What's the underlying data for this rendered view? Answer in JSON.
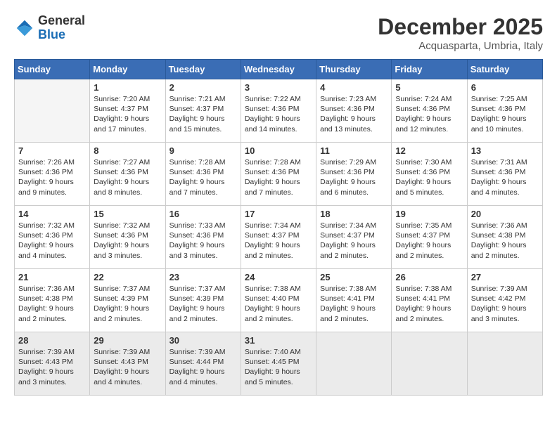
{
  "header": {
    "logo": {
      "general": "General",
      "blue": "Blue"
    },
    "title": "December 2025",
    "subtitle": "Acquasparta, Umbria, Italy"
  },
  "days_of_week": [
    "Sunday",
    "Monday",
    "Tuesday",
    "Wednesday",
    "Thursday",
    "Friday",
    "Saturday"
  ],
  "weeks": [
    [
      {
        "day": "",
        "info": ""
      },
      {
        "day": "1",
        "info": "Sunrise: 7:20 AM\nSunset: 4:37 PM\nDaylight: 9 hours\nand 17 minutes."
      },
      {
        "day": "2",
        "info": "Sunrise: 7:21 AM\nSunset: 4:37 PM\nDaylight: 9 hours\nand 15 minutes."
      },
      {
        "day": "3",
        "info": "Sunrise: 7:22 AM\nSunset: 4:36 PM\nDaylight: 9 hours\nand 14 minutes."
      },
      {
        "day": "4",
        "info": "Sunrise: 7:23 AM\nSunset: 4:36 PM\nDaylight: 9 hours\nand 13 minutes."
      },
      {
        "day": "5",
        "info": "Sunrise: 7:24 AM\nSunset: 4:36 PM\nDaylight: 9 hours\nand 12 minutes."
      },
      {
        "day": "6",
        "info": "Sunrise: 7:25 AM\nSunset: 4:36 PM\nDaylight: 9 hours\nand 10 minutes."
      }
    ],
    [
      {
        "day": "7",
        "info": "Sunrise: 7:26 AM\nSunset: 4:36 PM\nDaylight: 9 hours\nand 9 minutes."
      },
      {
        "day": "8",
        "info": "Sunrise: 7:27 AM\nSunset: 4:36 PM\nDaylight: 9 hours\nand 8 minutes."
      },
      {
        "day": "9",
        "info": "Sunrise: 7:28 AM\nSunset: 4:36 PM\nDaylight: 9 hours\nand 7 minutes."
      },
      {
        "day": "10",
        "info": "Sunrise: 7:28 AM\nSunset: 4:36 PM\nDaylight: 9 hours\nand 7 minutes."
      },
      {
        "day": "11",
        "info": "Sunrise: 7:29 AM\nSunset: 4:36 PM\nDaylight: 9 hours\nand 6 minutes."
      },
      {
        "day": "12",
        "info": "Sunrise: 7:30 AM\nSunset: 4:36 PM\nDaylight: 9 hours\nand 5 minutes."
      },
      {
        "day": "13",
        "info": "Sunrise: 7:31 AM\nSunset: 4:36 PM\nDaylight: 9 hours\nand 4 minutes."
      }
    ],
    [
      {
        "day": "14",
        "info": "Sunrise: 7:32 AM\nSunset: 4:36 PM\nDaylight: 9 hours\nand 4 minutes."
      },
      {
        "day": "15",
        "info": "Sunrise: 7:32 AM\nSunset: 4:36 PM\nDaylight: 9 hours\nand 3 minutes."
      },
      {
        "day": "16",
        "info": "Sunrise: 7:33 AM\nSunset: 4:36 PM\nDaylight: 9 hours\nand 3 minutes."
      },
      {
        "day": "17",
        "info": "Sunrise: 7:34 AM\nSunset: 4:37 PM\nDaylight: 9 hours\nand 2 minutes."
      },
      {
        "day": "18",
        "info": "Sunrise: 7:34 AM\nSunset: 4:37 PM\nDaylight: 9 hours\nand 2 minutes."
      },
      {
        "day": "19",
        "info": "Sunrise: 7:35 AM\nSunset: 4:37 PM\nDaylight: 9 hours\nand 2 minutes."
      },
      {
        "day": "20",
        "info": "Sunrise: 7:36 AM\nSunset: 4:38 PM\nDaylight: 9 hours\nand 2 minutes."
      }
    ],
    [
      {
        "day": "21",
        "info": "Sunrise: 7:36 AM\nSunset: 4:38 PM\nDaylight: 9 hours\nand 2 minutes."
      },
      {
        "day": "22",
        "info": "Sunrise: 7:37 AM\nSunset: 4:39 PM\nDaylight: 9 hours\nand 2 minutes."
      },
      {
        "day": "23",
        "info": "Sunrise: 7:37 AM\nSunset: 4:39 PM\nDaylight: 9 hours\nand 2 minutes."
      },
      {
        "day": "24",
        "info": "Sunrise: 7:38 AM\nSunset: 4:40 PM\nDaylight: 9 hours\nand 2 minutes."
      },
      {
        "day": "25",
        "info": "Sunrise: 7:38 AM\nSunset: 4:41 PM\nDaylight: 9 hours\nand 2 minutes."
      },
      {
        "day": "26",
        "info": "Sunrise: 7:38 AM\nSunset: 4:41 PM\nDaylight: 9 hours\nand 2 minutes."
      },
      {
        "day": "27",
        "info": "Sunrise: 7:39 AM\nSunset: 4:42 PM\nDaylight: 9 hours\nand 3 minutes."
      }
    ],
    [
      {
        "day": "28",
        "info": "Sunrise: 7:39 AM\nSunset: 4:43 PM\nDaylight: 9 hours\nand 3 minutes."
      },
      {
        "day": "29",
        "info": "Sunrise: 7:39 AM\nSunset: 4:43 PM\nDaylight: 9 hours\nand 4 minutes."
      },
      {
        "day": "30",
        "info": "Sunrise: 7:39 AM\nSunset: 4:44 PM\nDaylight: 9 hours\nand 4 minutes."
      },
      {
        "day": "31",
        "info": "Sunrise: 7:40 AM\nSunset: 4:45 PM\nDaylight: 9 hours\nand 5 minutes."
      },
      {
        "day": "",
        "info": ""
      },
      {
        "day": "",
        "info": ""
      },
      {
        "day": "",
        "info": ""
      }
    ]
  ]
}
